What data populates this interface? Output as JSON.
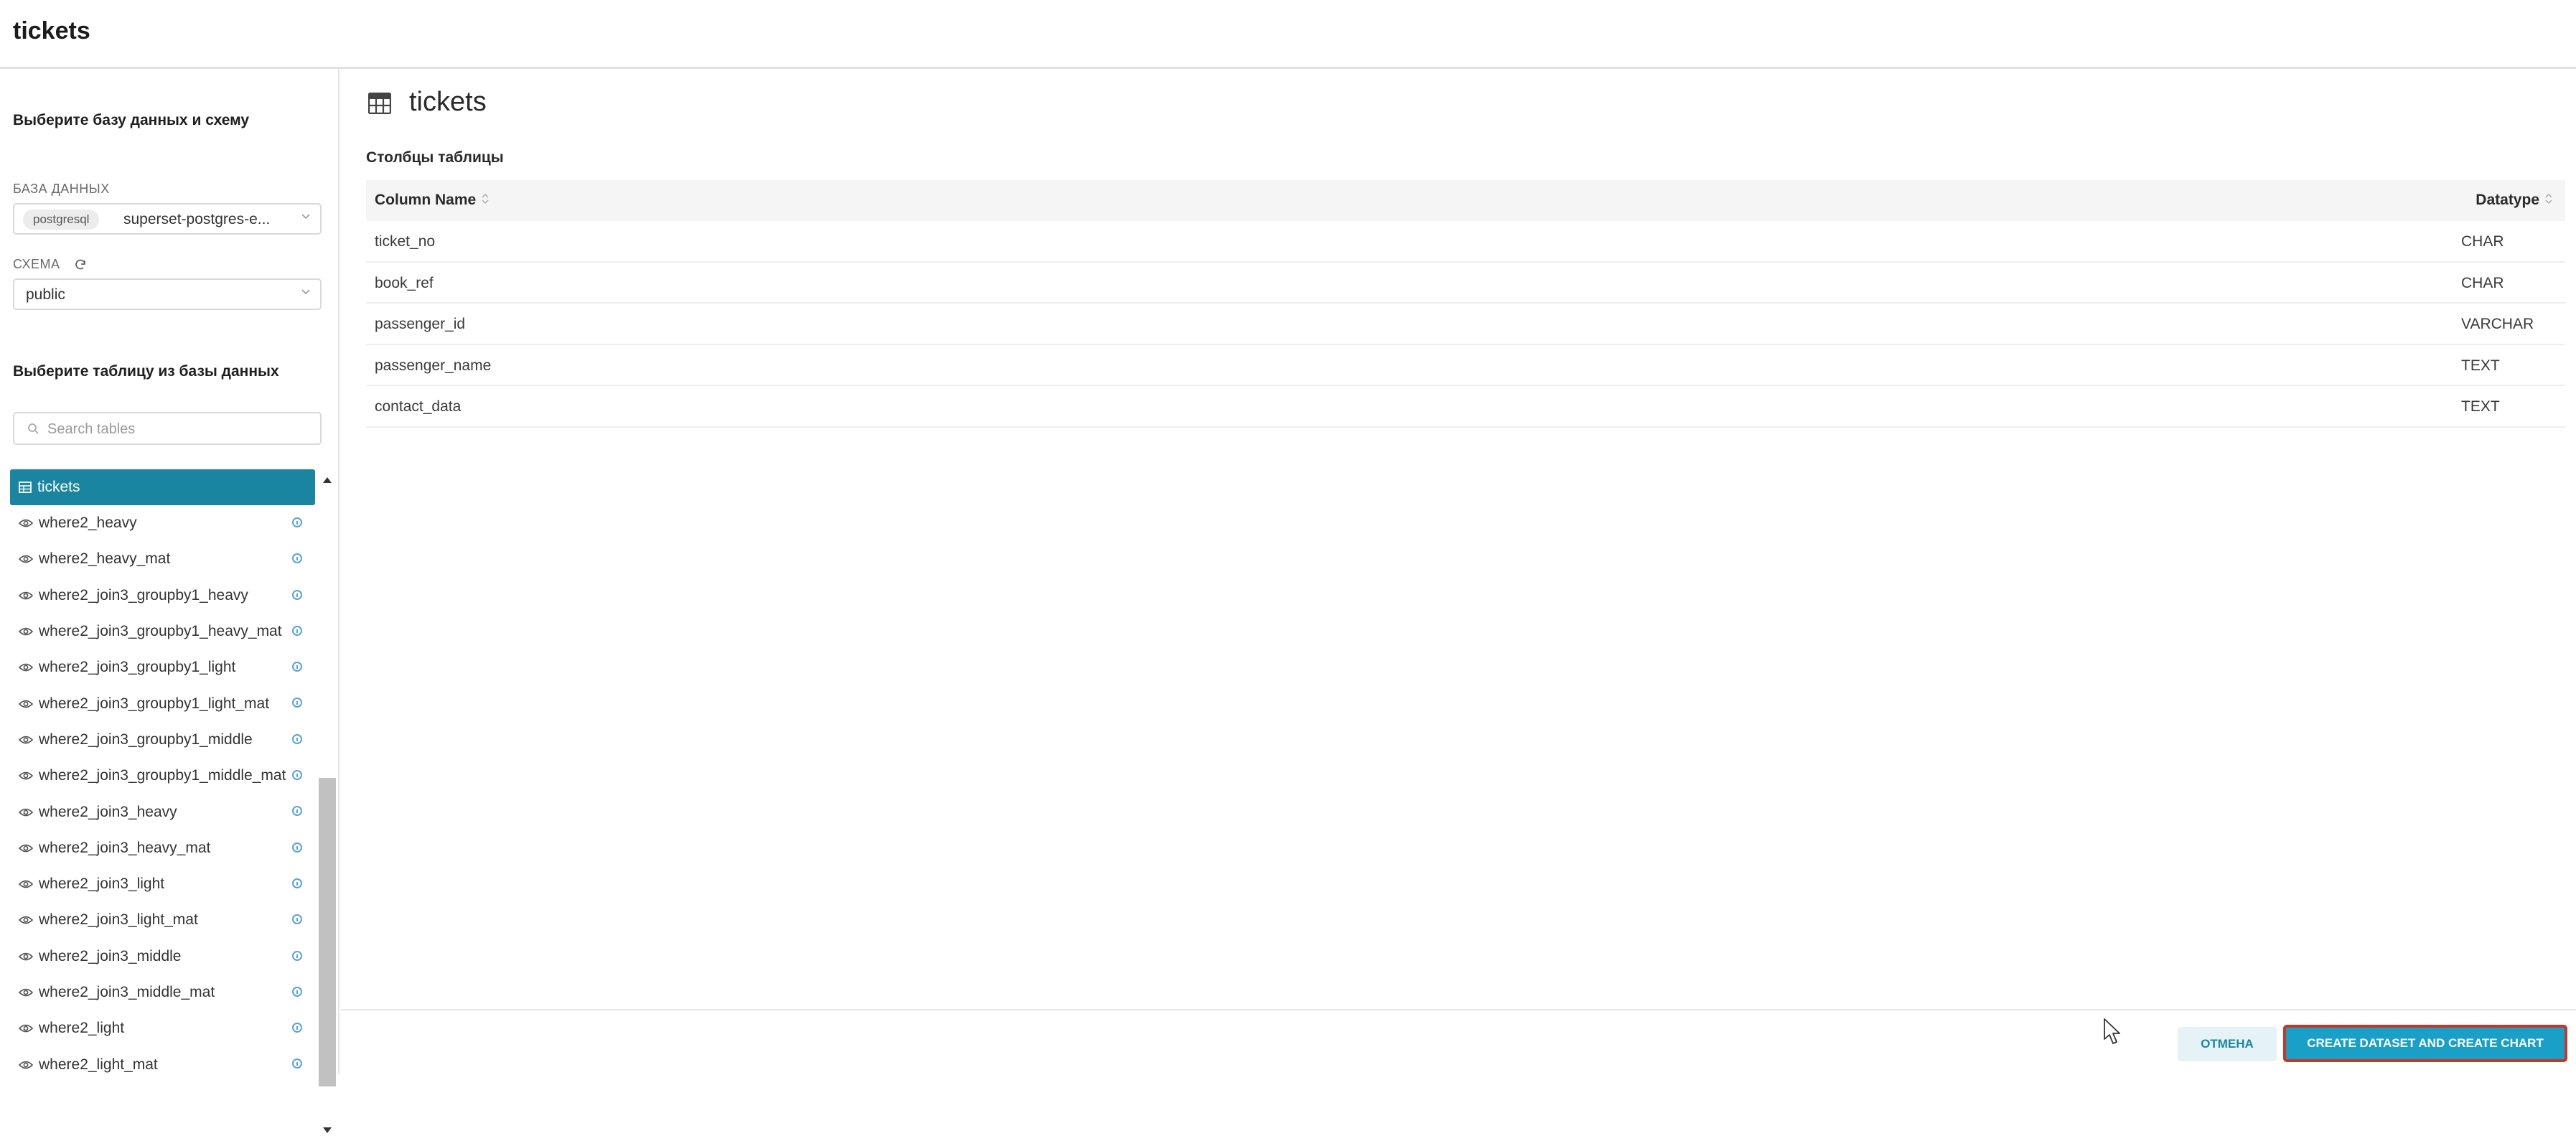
{
  "header": {
    "title": "tickets"
  },
  "sidebar": {
    "db_section_title": "Выберите базу данных и схему",
    "database_label": "БАЗА ДАННЫХ",
    "database_tag": "postgresql",
    "database_value": "superset-postgres-e...",
    "schema_label": "СХЕМА",
    "schema_value": "public",
    "table_section_title": "Выберите таблицу из базы данных",
    "search_placeholder": "Search tables",
    "selected_table": "tickets",
    "tables": [
      "where2_heavy",
      "where2_heavy_mat",
      "where2_join3_groupby1_heavy",
      "where2_join3_groupby1_heavy_mat",
      "where2_join3_groupby1_light",
      "where2_join3_groupby1_light_mat",
      "where2_join3_groupby1_middle",
      "where2_join3_groupby1_middle_mat",
      "where2_join3_heavy",
      "where2_join3_heavy_mat",
      "where2_join3_light",
      "where2_join3_light_mat",
      "where2_join3_middle",
      "where2_join3_middle_mat",
      "where2_light",
      "where2_light_mat"
    ]
  },
  "main": {
    "title": "tickets",
    "subtitle": "Столбцы таблицы",
    "columns_header": {
      "name": "Column Name",
      "type": "Datatype"
    },
    "rows": [
      {
        "name": "ticket_no",
        "type": "CHAR"
      },
      {
        "name": "book_ref",
        "type": "CHAR"
      },
      {
        "name": "passenger_id",
        "type": "VARCHAR"
      },
      {
        "name": "passenger_name",
        "type": "TEXT"
      },
      {
        "name": "contact_data",
        "type": "TEXT"
      }
    ]
  },
  "footer": {
    "cancel_label": "ОТМЕНА",
    "create_label": "CREATE DATASET AND CREATE CHART"
  },
  "colors": {
    "accent": "#1a85a0",
    "primary_button": "#1a9fc6",
    "highlight_border": "#c0392b"
  }
}
